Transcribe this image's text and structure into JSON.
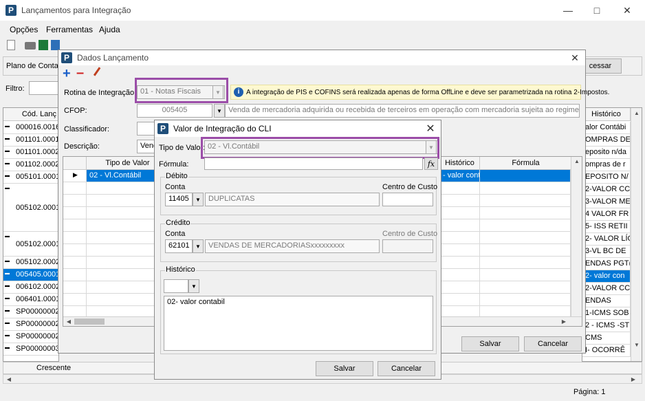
{
  "main_window": {
    "title": "Lançamentos para Integração",
    "menu": [
      "Opções",
      "Ferramentas",
      "Ajuda"
    ],
    "plano_label": "Plano de Contas",
    "filtro_label": "Filtro:",
    "processar_button": "cessar",
    "left_header": "Cód. Lanç",
    "left_rows": [
      "000016.0016",
      "001101.0001",
      "001101.0002",
      "001102.0002",
      "005101.0001",
      "005102.0001",
      "005102.0001",
      "005102.0002",
      "005405.0001",
      "006102.0002",
      "006401.0001",
      "SP000000020",
      "SP000000020",
      "SP000000020",
      "SP000000030"
    ],
    "right_header": "Histórico",
    "right_rows": [
      "alor Contábi",
      "OMPRAS DE",
      "eposito n/da",
      "ompras de r",
      "EPOSITO N/",
      "2-VALOR CC",
      "3-VALOR ME",
      "4 VALOR FR",
      "5- ISS RETII",
      "2- VALOR LÍC",
      "3-VL BC DE",
      "ENDAS PGT(",
      "2- valor con",
      "2-VALOR CC",
      "ENDAS",
      "1-ICMS SOB",
      "2 - ICMS -ST",
      "CMS",
      "I- OCORRÊ"
    ],
    "footer_crescente": "Crescente",
    "status_page": "Página: 1"
  },
  "dados_dialog": {
    "title": "Dados Lançamento",
    "rotina_label": "Rotina de Integração:",
    "rotina_value": "01 - Notas Fiscais",
    "info_text": "A integração de PIS e COFINS será realizada apenas de forma OffLine e deve ser parametrizada na rotina 2-Impostos.",
    "cfop_label": "CFOP:",
    "cfop_value": "005405",
    "cfop_desc": "Venda de mercadoria adquirida ou recebida de terceiros em operação com mercadoria sujeita ao regime de subst",
    "classificador_label": "Classificador:",
    "descricao_label": "Descrição:",
    "descricao_value": "Venda",
    "grid_headers": [
      "Tipo de Valor",
      "Histórico",
      "Fórmula"
    ],
    "grid_row_tipo": "02 - Vl.Contábil",
    "grid_row_hist": "- valor cont",
    "salvar": "Salvar",
    "cancelar": "Cancelar"
  },
  "cli_dialog": {
    "title": "Valor de Integração do CLI",
    "tipo_label": "Tipo de Valor:",
    "tipo_value": "02 - Vl.Contábil",
    "formula_label": "Fórmula:",
    "fx": "fx",
    "debito": {
      "label": "Débito",
      "conta_label": "Conta",
      "centro_label": "Centro de Custo",
      "conta_value": "11405",
      "conta_desc": "DUPLICATAS"
    },
    "credito": {
      "label": "Crédito",
      "conta_label": "Conta",
      "centro_label": "Centro de Custo",
      "conta_value": "62101",
      "conta_desc": "VENDAS DE MERCADORIASxxxxxxxxx"
    },
    "historico_label": "Histórico",
    "historico_text": "02- valor contabil",
    "salvar": "Salvar",
    "cancelar": "Cancelar"
  }
}
